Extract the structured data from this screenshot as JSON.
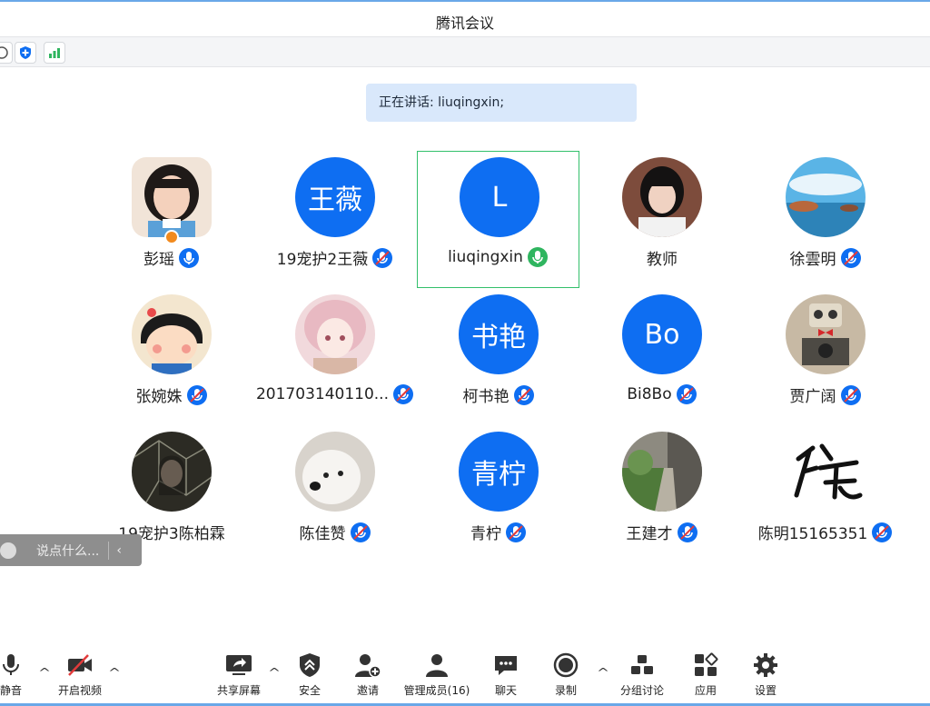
{
  "window": {
    "title": "腾讯会议"
  },
  "speaking": {
    "text": "正在讲话: liuqingxin;"
  },
  "participants": [
    {
      "name": "彭瑶",
      "avatar": "photo-girl-icon",
      "host": true
    },
    {
      "name": "19宠护2王薇",
      "avatar_text": "王薇"
    },
    {
      "name": "liuqingxin",
      "avatar_text": "L",
      "active": true
    },
    {
      "name": "教师",
      "avatar": "photo-woman-icon"
    },
    {
      "name": "徐雲明",
      "avatar": "photo-sky-icon"
    },
    {
      "name": "张婉姝",
      "avatar": "cartoon-girl-icon"
    },
    {
      "name": "201703140110...",
      "avatar": "anime-girl-icon"
    },
    {
      "name": "柯书艳",
      "avatar_text": "书艳"
    },
    {
      "name": "Bi8Bo",
      "avatar_text": "Bo"
    },
    {
      "name": "贾广阔",
      "avatar": "robot-icon"
    },
    {
      "name": "19宠护3陈柏霖",
      "avatar": "dark-portrait-icon"
    },
    {
      "name": "陈佳赞",
      "avatar": "dog-icon"
    },
    {
      "name": "青柠",
      "avatar_text": "青柠"
    },
    {
      "name": "王建才",
      "avatar": "garden-path-icon"
    },
    {
      "name": "陈明15165351",
      "avatar": "calligraphy-icon"
    }
  ],
  "chat": {
    "placeholder": "说点什么...",
    "collapse_icon": "‹"
  },
  "toolbar": {
    "mute": "静音",
    "video": "开启视频",
    "share": "共享屏幕",
    "security": "安全",
    "invite": "邀请",
    "members": "管理成员(16)",
    "chat": "聊天",
    "record": "录制",
    "breakout": "分组讨论",
    "apps": "应用",
    "settings": "设置"
  },
  "colors": {
    "accent": "#0e6ef2",
    "active_border": "#33c06b",
    "speaking_bg": "#d9e8fb",
    "mic_on": "#2fb55f"
  }
}
